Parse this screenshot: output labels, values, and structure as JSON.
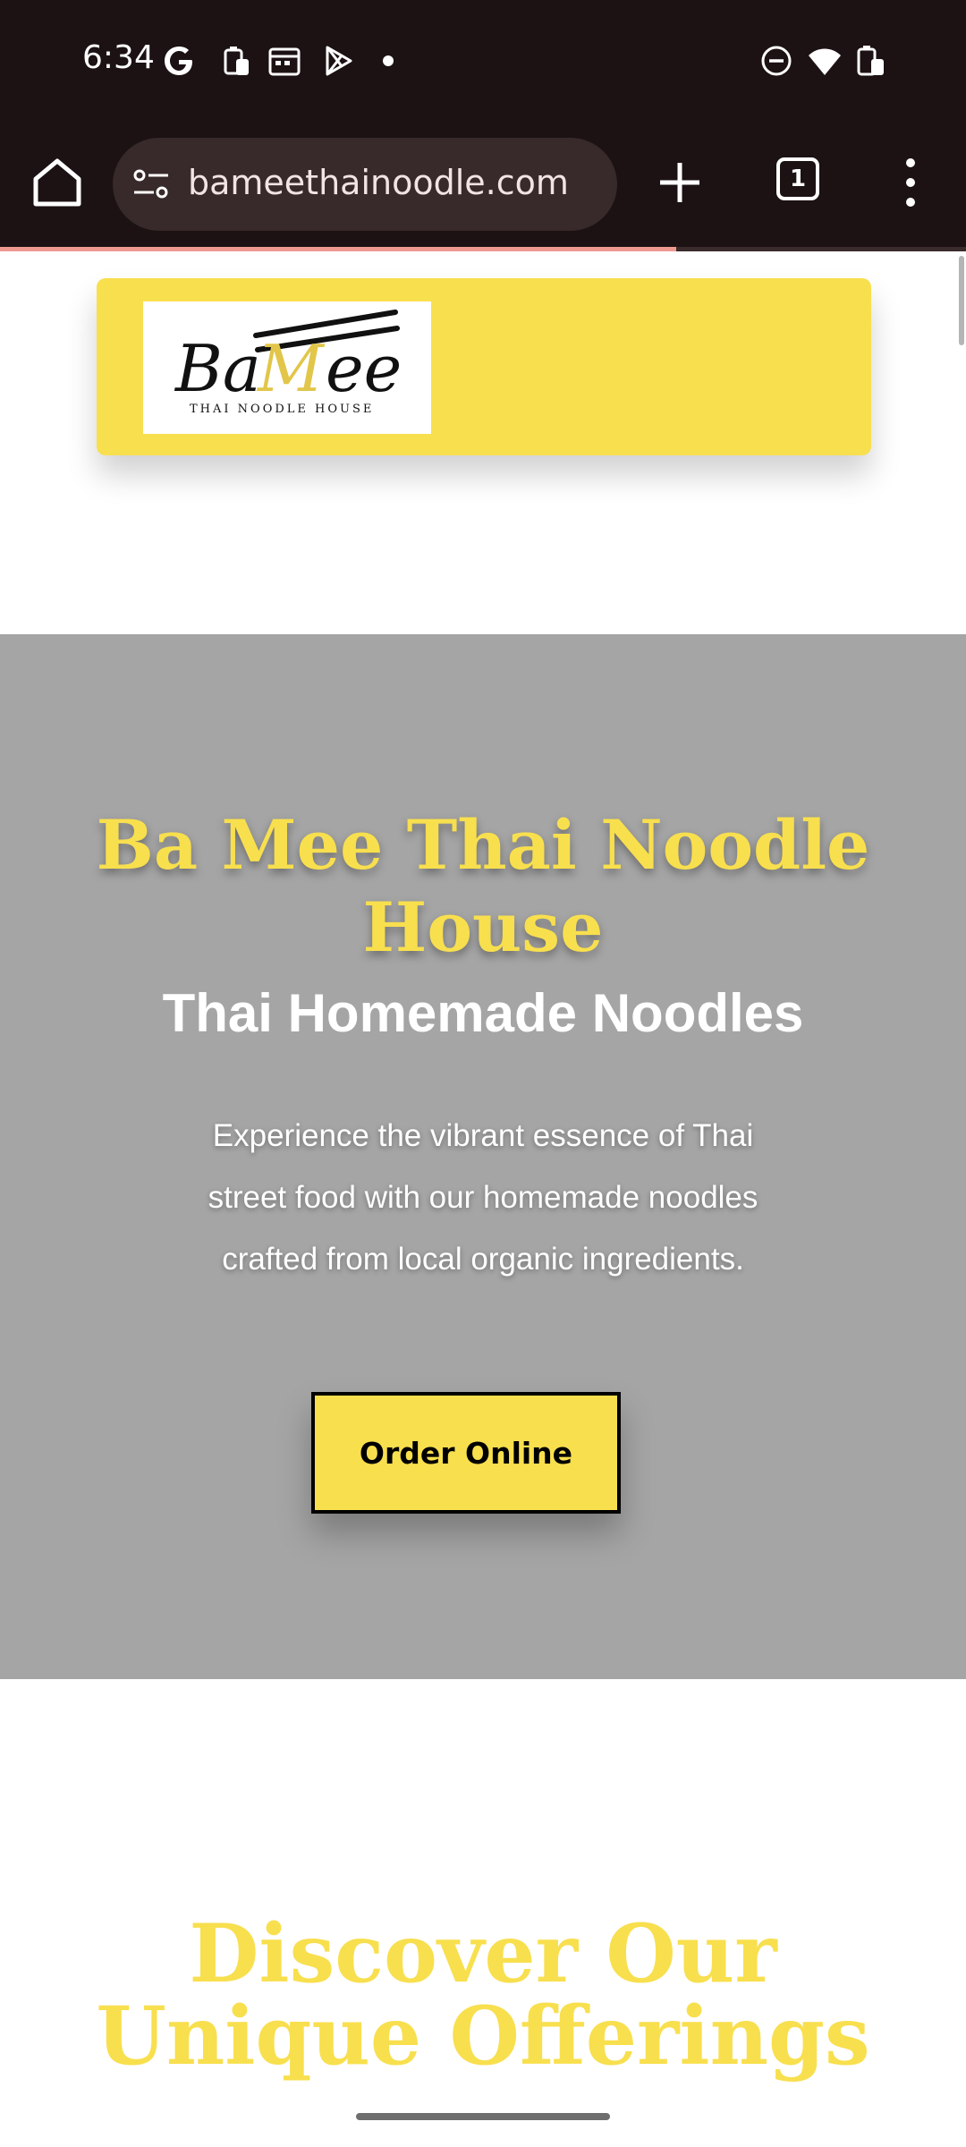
{
  "status_bar": {
    "time": "6:34",
    "left_icons": [
      "google-icon",
      "battery-saver-icon",
      "calendar-icon",
      "play-store-icon",
      "notification-dot"
    ],
    "right_icons": [
      "do-not-disturb-icon",
      "wifi-icon",
      "battery-icon"
    ]
  },
  "browser": {
    "url": "bameethainoodle.com",
    "tab_count": "1",
    "load_progress": 0.7
  },
  "header": {
    "logo_text": "BaMee",
    "logo_tagline": "Thai Noodle House"
  },
  "hero": {
    "title": "Ba Mee Thai Noodle House",
    "subtitle": "Thai Homemade Noodles",
    "description": "Experience the vibrant essence of Thai street food with our homemade noodles crafted from local organic ingredients.",
    "cta_label": "Order Online"
  },
  "offerings": {
    "title": "Discover Our Unique Offerings"
  },
  "colors": {
    "accent": "#f8df4e",
    "hero_bg": "#a5a5a5",
    "chrome_bg": "#1c1213"
  }
}
